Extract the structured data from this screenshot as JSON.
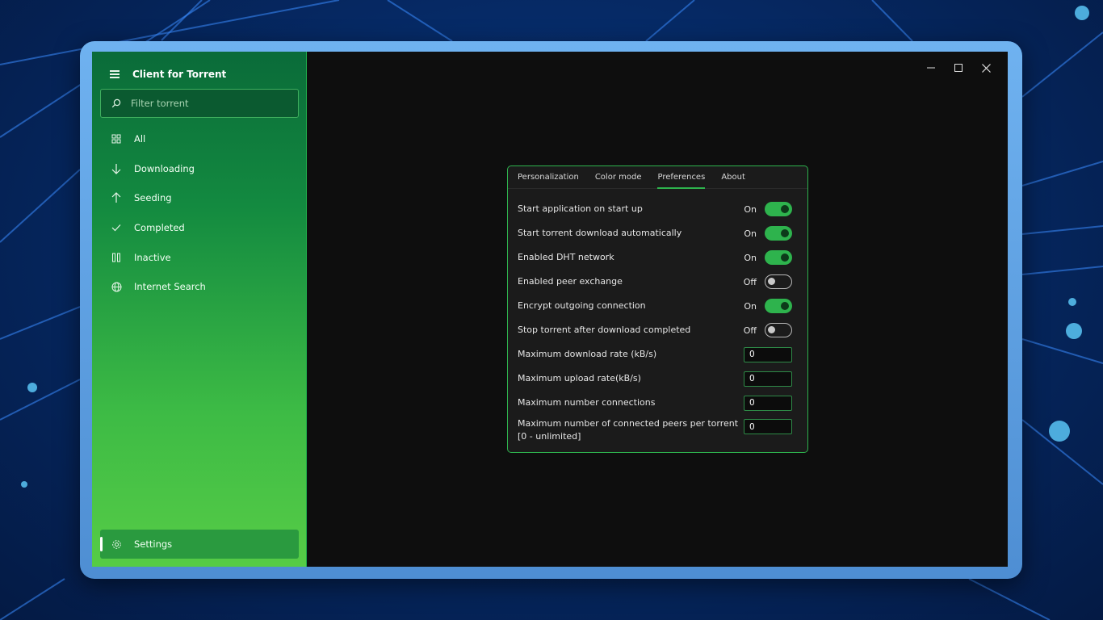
{
  "app": {
    "title": "Client for Torrent"
  },
  "search": {
    "placeholder": "Filter torrent"
  },
  "sidebar": {
    "items": [
      {
        "label": "All",
        "icon": "grid-icon"
      },
      {
        "label": "Downloading",
        "icon": "arrow-down-icon"
      },
      {
        "label": "Seeding",
        "icon": "arrow-up-icon"
      },
      {
        "label": "Completed",
        "icon": "checkmark-icon"
      },
      {
        "label": "Inactive",
        "icon": "pause-icon"
      },
      {
        "label": "Internet Search",
        "icon": "globe-icon"
      }
    ],
    "settings_label": "Settings"
  },
  "tabs": [
    "Personalization",
    "Color mode",
    "Preferences",
    "About"
  ],
  "active_tab": "Preferences",
  "preferences": {
    "toggles": [
      {
        "label": "Start application on start up",
        "state": "On"
      },
      {
        "label": "Start torrent download automatically",
        "state": "On"
      },
      {
        "label": "Enabled DHT network",
        "state": "On"
      },
      {
        "label": "Enabled peer exchange",
        "state": "Off"
      },
      {
        "label": "Encrypt outgoing connection",
        "state": "On"
      },
      {
        "label": "Stop torrent after download completed",
        "state": "Off"
      }
    ],
    "inputs": [
      {
        "label": "Maximum download rate (kB/s)",
        "value": "0"
      },
      {
        "label": "Maximum upload rate(kB/s)",
        "value": "0"
      },
      {
        "label": "Maximum number connections",
        "value": "0"
      },
      {
        "label": "Maximum number of connected peers per torrent",
        "label2": "[0 - unlimited]",
        "value": "0"
      }
    ]
  },
  "colors": {
    "accent": "#2eb34d",
    "sidebar_top": "#0a6b39",
    "sidebar_bottom": "#56cc46"
  }
}
